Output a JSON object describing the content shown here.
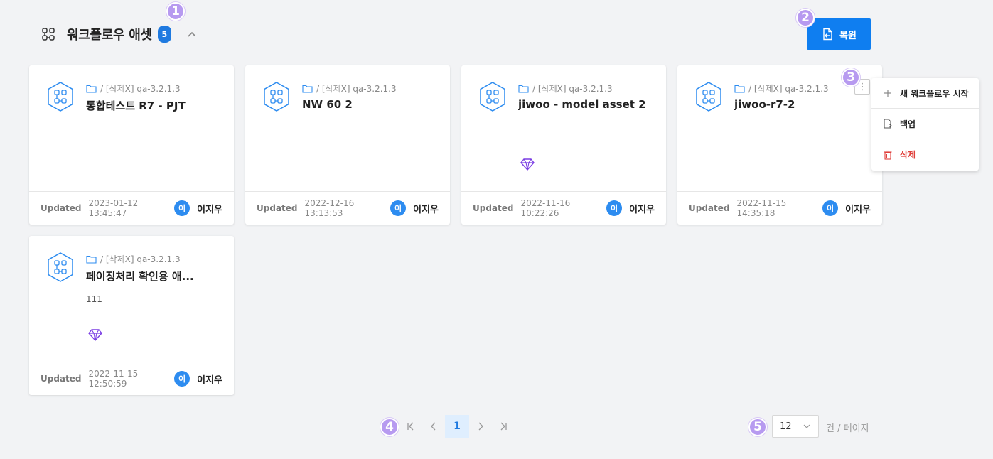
{
  "header": {
    "title": "워크플로우 애셋",
    "count": "5"
  },
  "restore_button": {
    "label": "복원"
  },
  "markers": [
    "1",
    "2",
    "3",
    "4",
    "5"
  ],
  "cards": [
    {
      "path": "/ [삭제X] qa-3.2.1.3",
      "name": "통합테스트 R7 - PJT",
      "desc": "",
      "has_gem": false,
      "updated_label": "Updated",
      "date": "2023-01-12 13:45:47",
      "avatar": "이",
      "user": "이지우"
    },
    {
      "path": "/ [삭제X] qa-3.2.1.3",
      "name": "NW 60 2",
      "desc": "",
      "has_gem": false,
      "updated_label": "Updated",
      "date": "2022-12-16 13:13:53",
      "avatar": "이",
      "user": "이지우"
    },
    {
      "path": "/ [삭제X] qa-3.2.1.3",
      "name": "jiwoo - model asset 2",
      "desc": "",
      "has_gem": true,
      "updated_label": "Updated",
      "date": "2022-11-16 10:22:26",
      "avatar": "이",
      "user": "이지우"
    },
    {
      "path": "/ [삭제X] qa-3.2.1.3",
      "name": "jiwoo-r7-2",
      "desc": "",
      "has_gem": false,
      "updated_label": "Updated",
      "date": "2022-11-15 14:35:18",
      "avatar": "이",
      "user": "이지우"
    },
    {
      "path": "/ [삭제X] qa-3.2.1.3",
      "name": "페이징처리 확인용 애...",
      "desc": "111",
      "has_gem": true,
      "updated_label": "Updated",
      "date": "2022-11-15 12:50:59",
      "avatar": "이",
      "user": "이지우"
    }
  ],
  "context_menu": {
    "items": [
      {
        "label": "새 워크플로우 시작",
        "icon": "plus-icon"
      },
      {
        "label": "백업",
        "icon": "file-export-icon"
      },
      {
        "label": "삭제",
        "icon": "trash-icon"
      }
    ]
  },
  "pagination": {
    "current": "1"
  },
  "page_size": {
    "value": "12",
    "suffix": "건 / 페이지"
  },
  "colors": {
    "accent": "#0f7ef0",
    "badge": "#1f7ae0",
    "danger": "#e0413c",
    "gem": "#7b3fe4",
    "marker": "#b79af0"
  }
}
